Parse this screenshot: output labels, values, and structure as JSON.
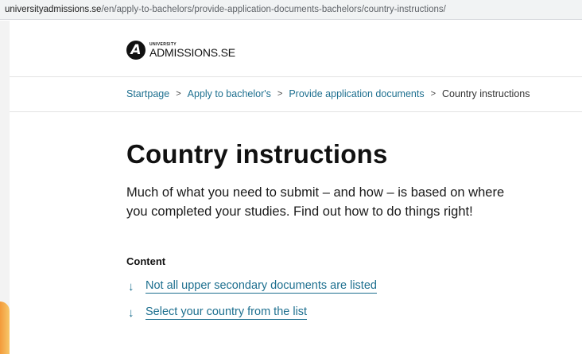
{
  "browser": {
    "url_domain": "universityadmissions.se",
    "url_path": "/en/apply-to-bachelors/provide-application-documents-bachelors/country-instructions/"
  },
  "header": {
    "logo_letter": "A",
    "logo_small": "UNIVERSITY",
    "logo_big": "ADMISSIONS.SE"
  },
  "breadcrumb": {
    "items": [
      "Startpage",
      "Apply to bachelor's",
      "Provide application documents"
    ],
    "separator": ">",
    "current": "Country instructions"
  },
  "main": {
    "title": "Country instructions",
    "intro": "Much of what you need to submit – and how – is based on where you completed your studies. Find out how to do things right!",
    "content_label": "Content",
    "toc": [
      {
        "label": "Not all upper secondary documents are listed",
        "icon": "arrow-down-icon"
      },
      {
        "label": "Select your country from the list",
        "icon": "arrow-down-icon"
      }
    ]
  },
  "colors": {
    "link": "#1d6f8f",
    "accent_orange": "#f39a3a"
  }
}
